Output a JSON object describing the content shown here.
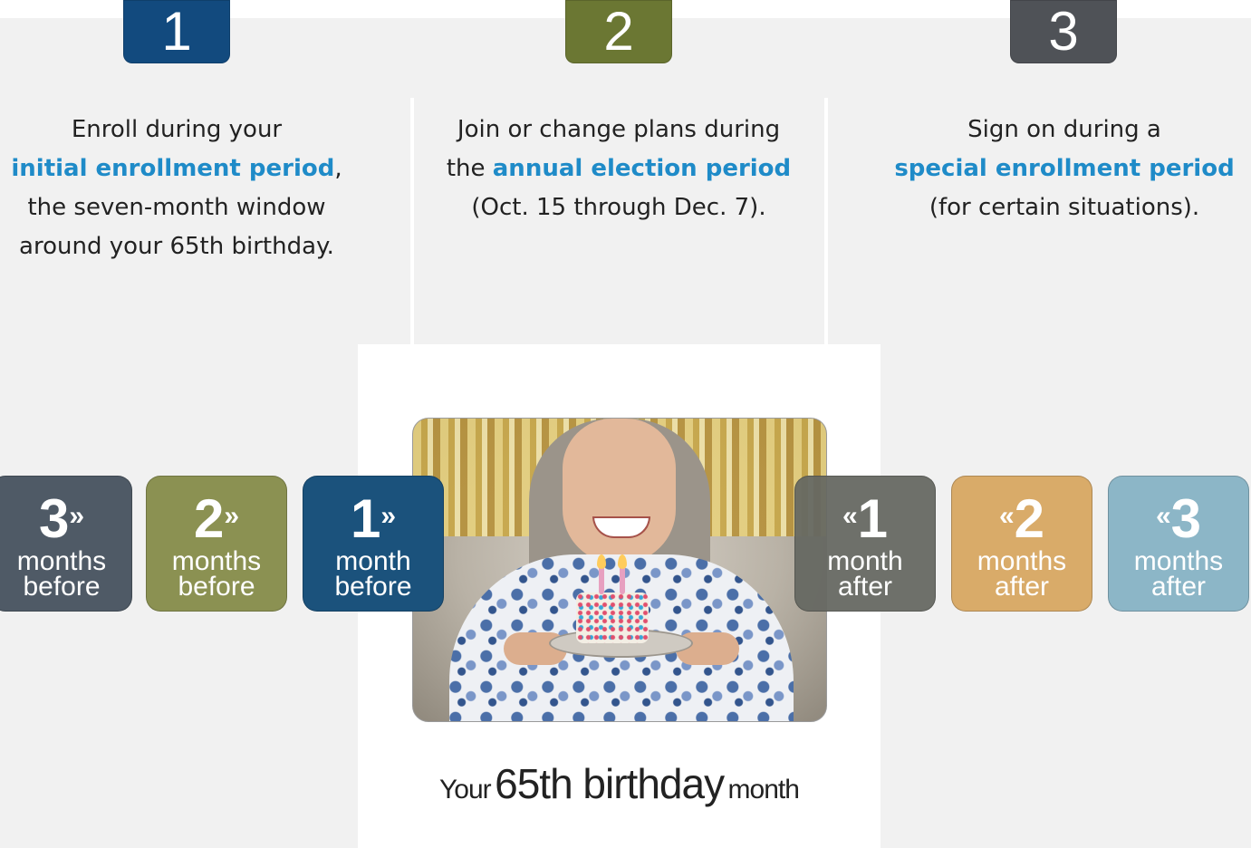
{
  "colors": {
    "step1": "#124a7e",
    "step2": "#6b7733",
    "step3": "#4f5257",
    "highlight": "#1f8bc8",
    "tile_3_before": "#4f5a66",
    "tile_2_before": "#8b9152",
    "tile_1_before": "#1b527c",
    "tile_1_after": "#666862",
    "tile_2_after": "#d9ab69",
    "tile_3_after": "#8cb6c7"
  },
  "steps": [
    {
      "number": "1",
      "line1": "Enroll during your",
      "highlight": "initial enrollment period",
      "after_highlight": ",",
      "line3": "the seven-month window",
      "line4": "around your 65th birthday."
    },
    {
      "number": "2",
      "line1": "Join or change plans during",
      "before_highlight": "the ",
      "highlight": "annual election period",
      "line3": "(Oct. 15 through Dec. 7)."
    },
    {
      "number": "3",
      "line1": "Sign on during a",
      "highlight": "special enrollment period",
      "line3": "(for certain situations)."
    }
  ],
  "timeline": {
    "before": [
      {
        "num": "3",
        "arrow": "»",
        "unit": "months",
        "rel": "before"
      },
      {
        "num": "2",
        "arrow": "»",
        "unit": "months",
        "rel": "before"
      },
      {
        "num": "1",
        "arrow": "»",
        "unit": "month",
        "rel": "before"
      }
    ],
    "after": [
      {
        "num": "1",
        "arrow": "«",
        "unit": "month",
        "rel": "after"
      },
      {
        "num": "2",
        "arrow": "«",
        "unit": "months",
        "rel": "after"
      },
      {
        "num": "3",
        "arrow": "«",
        "unit": "months",
        "rel": "after"
      }
    ]
  },
  "center": {
    "prefix": "Your",
    "main": "65th birthday",
    "suffix": "month",
    "photo": "woman-holding-birthday-cake-photo"
  }
}
